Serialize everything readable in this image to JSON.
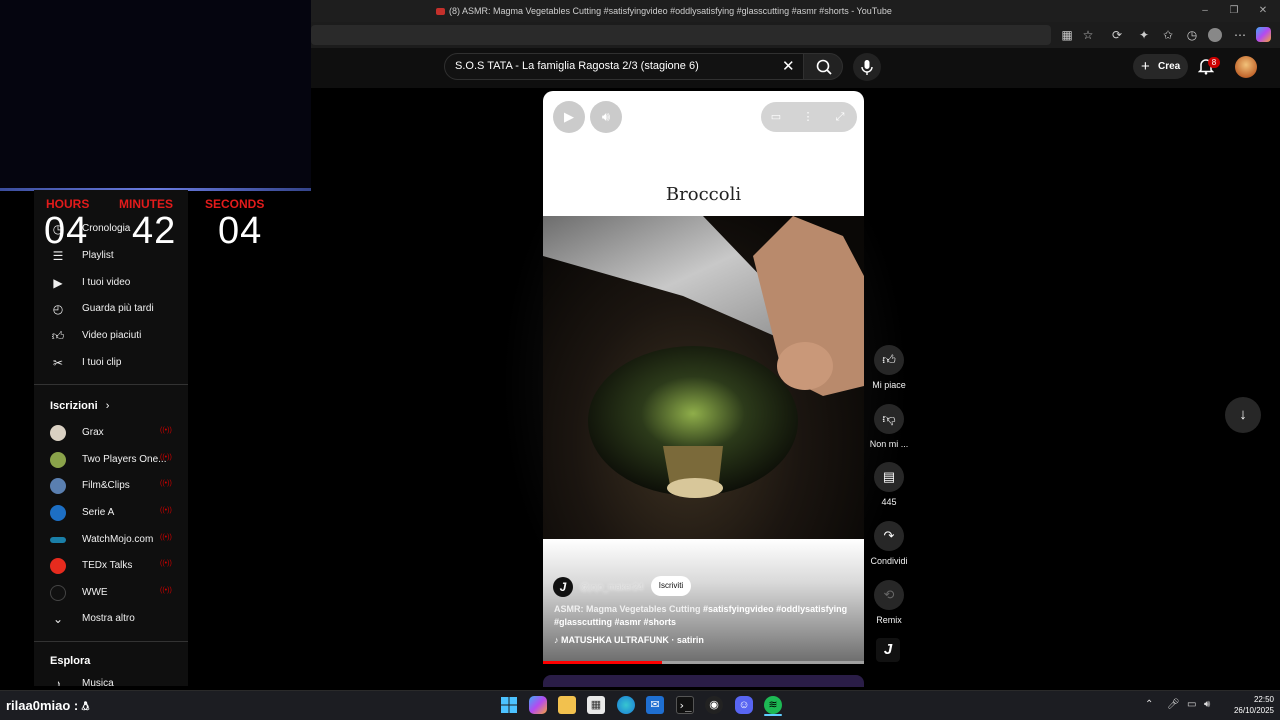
{
  "browser": {
    "tab_title": "(8) ASMR: Magma Vegetables Cutting #satisfyingvideo #oddlysatisfying #glasscutting #asmr #shorts - YouTube",
    "window_controls": [
      "minimize-icon",
      "restore-icon",
      "close-icon"
    ],
    "toolbar_icons": [
      "tab-icon",
      "star-icon",
      "extension-icon",
      "puzzle-icon",
      "favorites-icon",
      "history-icon",
      "profile-icon",
      "more-icon",
      "copilot-icon"
    ]
  },
  "header": {
    "search_value": "S.O.S TATA - La famiglia Ragosta 2/3 (stagione 6)",
    "create_label": "Crea",
    "notification_count": "8"
  },
  "timer": {
    "hours_label": "HOURS",
    "minutes_label": "MINUTES",
    "seconds_label": "SECONDS",
    "hours": "04",
    "minutes": "42",
    "seconds": "04"
  },
  "sidebar": {
    "you_items": [
      {
        "label": "Cronologia",
        "icon": "history-icon"
      },
      {
        "label": "Playlist",
        "icon": "playlist-icon"
      },
      {
        "label": "I tuoi video",
        "icon": "video-icon"
      },
      {
        "label": "Guarda più tardi",
        "icon": "clock-icon"
      },
      {
        "label": "Video piaciuti",
        "icon": "thumbs-up-icon"
      },
      {
        "label": "I tuoi clip",
        "icon": "scissors-icon"
      }
    ],
    "subscriptions_title": "Iscrizioni",
    "subscriptions": [
      {
        "label": "Grax",
        "color": "#d9d0c2"
      },
      {
        "label": "Two Players One...",
        "color": "#8aa34a"
      },
      {
        "label": "Film&Clips",
        "color": "#5a7fb0"
      },
      {
        "label": "Serie A",
        "color": "#1d6fc4"
      },
      {
        "label": "WatchMojo.com",
        "color": "#1a7fa8"
      },
      {
        "label": "TEDx Talks",
        "color": "#e62b1e"
      },
      {
        "label": "WWE",
        "color": "#111111"
      }
    ],
    "show_more_label": "Mostra altro",
    "explore_title": "Esplora",
    "explore_first_item": "Musica"
  },
  "short": {
    "title_overlay": "Broccoli",
    "channel_initial": "J",
    "channel_handle": "@jojo_maker24",
    "subscribe_label": "Iscriviti",
    "description": "ASMR: Magma Vegetables Cutting",
    "description_tags": "#satisfyingvideo #oddlysatisfying #glasscutting #asmr #shorts",
    "music": "MATUSHKA ULTRAFUNK · satirin",
    "progress": 0.37
  },
  "actions": {
    "like_label": "Mi piace",
    "dislike_label": "Non mi ...",
    "comments_count": "445",
    "share_label": "Condividi",
    "remix_label": "Remix"
  },
  "taskbar": {
    "user_label": "rilaa0miao :",
    "apps": [
      "windows-start-icon",
      "copilot-icon",
      "file-explorer-icon",
      "store-icon",
      "edge-icon",
      "outlook-icon",
      "terminal-icon",
      "github-icon",
      "discord-icon",
      "spotify-icon"
    ],
    "time": "22:50",
    "date": "26/10/2025"
  }
}
